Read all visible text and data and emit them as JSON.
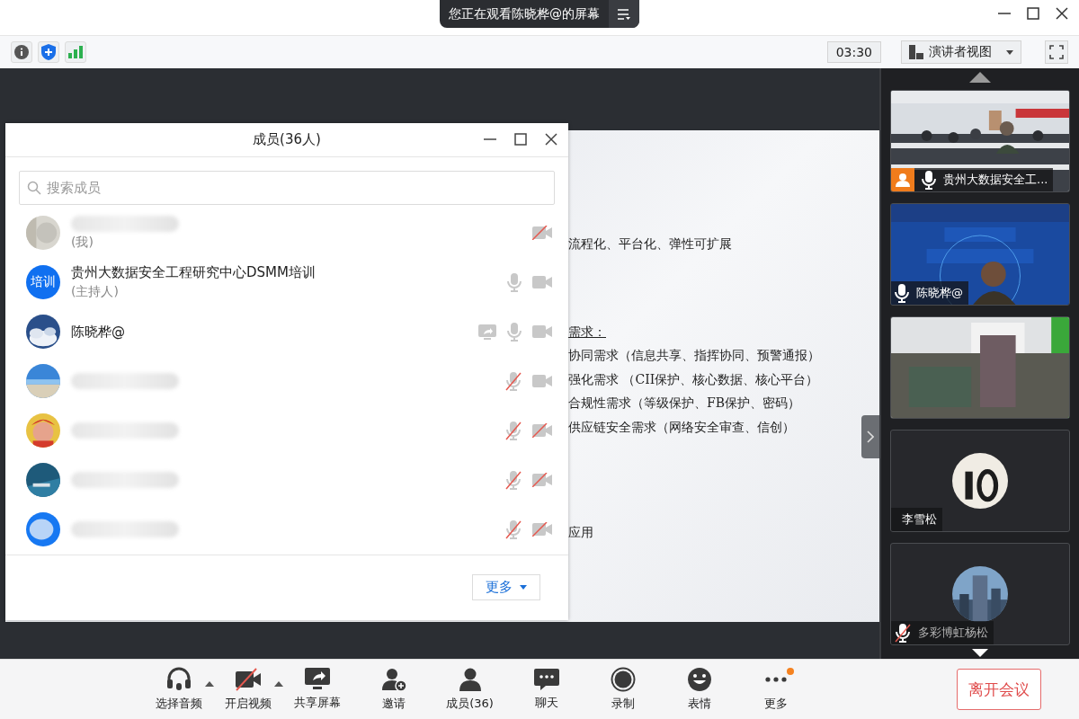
{
  "window": {
    "banner": "您正在观看陈晓桦@的屏幕"
  },
  "toolbar": {
    "timer": "03:30",
    "view_mode": "演讲者视图"
  },
  "slide": {
    "lines": [
      {
        "text": "流程化、平台化、弹性可扩展",
        "kind": "plain"
      },
      {
        "text": "需求：",
        "kind": "heading"
      },
      {
        "text": "协同需求（信息共享、指挥协同、预警通报）",
        "kind": "plain"
      },
      {
        "text": "强化需求 （CII保护、核心数据、核心平台）",
        "kind": "plain"
      },
      {
        "text": "合规性需求（等级保护、FB保护、密码）",
        "kind": "plain"
      },
      {
        "text": "供应链安全需求（网络安全审查、信创）",
        "kind": "plain"
      },
      {
        "text": "应用",
        "kind": "plain"
      }
    ]
  },
  "members_panel": {
    "title": "成员(36人)",
    "search": {
      "placeholder": "搜索成员"
    },
    "members": [
      {
        "name_hidden": true,
        "role": "(我)",
        "camera_off": true,
        "sharing": false
      },
      {
        "name_hidden": false,
        "avatar_text": "培训",
        "name": "贵州大数据安全工程研究中心DSMM培训",
        "role": "(主持人)",
        "mic_muted": false,
        "camera_off": false,
        "sharing": false
      },
      {
        "name_hidden": false,
        "name": "陈晓桦@",
        "mic_muted": false,
        "camera_off": false,
        "sharing": true
      },
      {
        "name_hidden": true,
        "mic_muted": true,
        "camera_off": false,
        "sharing": false
      },
      {
        "name_hidden": true,
        "mic_muted": true,
        "camera_off": true,
        "sharing": false
      },
      {
        "name_hidden": true,
        "mic_muted": true,
        "camera_off": true,
        "sharing": false
      },
      {
        "name_hidden": true,
        "mic_muted": true,
        "camera_off": true,
        "sharing": false
      }
    ],
    "more_button": "更多"
  },
  "video_tiles": [
    {
      "kind": "video",
      "user_badge": true,
      "mic_muted": false,
      "name": "贵州大数据安全工..."
    },
    {
      "kind": "video",
      "user_badge": false,
      "mic_muted": false,
      "name": "陈晓桦@"
    },
    {
      "kind": "video",
      "user_badge": false
    },
    {
      "kind": "avatar",
      "user_badge": false,
      "name": "李雪松"
    },
    {
      "kind": "avatar",
      "user_badge": false,
      "mic_muted": true,
      "name": "多彩博虹杨松"
    }
  ],
  "controls": [
    {
      "kind": "headset",
      "label": "选择音频",
      "caret": true,
      "badge": false
    },
    {
      "kind": "camera-off",
      "label": "开启视频",
      "caret": true,
      "badge": false
    },
    {
      "kind": "share",
      "label": "共享屏幕",
      "caret": false,
      "badge": false
    },
    {
      "kind": "invite",
      "label": "邀请",
      "caret": false,
      "badge": false
    },
    {
      "kind": "members",
      "label": "成员(36)",
      "caret": false,
      "badge": false
    },
    {
      "kind": "chat",
      "label": "聊天",
      "caret": false,
      "badge": false
    },
    {
      "kind": "record",
      "label": "录制",
      "caret": false,
      "badge": false
    },
    {
      "kind": "emoji",
      "label": "表情",
      "caret": false,
      "badge": false
    },
    {
      "kind": "more",
      "label": "更多",
      "caret": false,
      "badge": true
    }
  ],
  "leave_button": "离开会议"
}
